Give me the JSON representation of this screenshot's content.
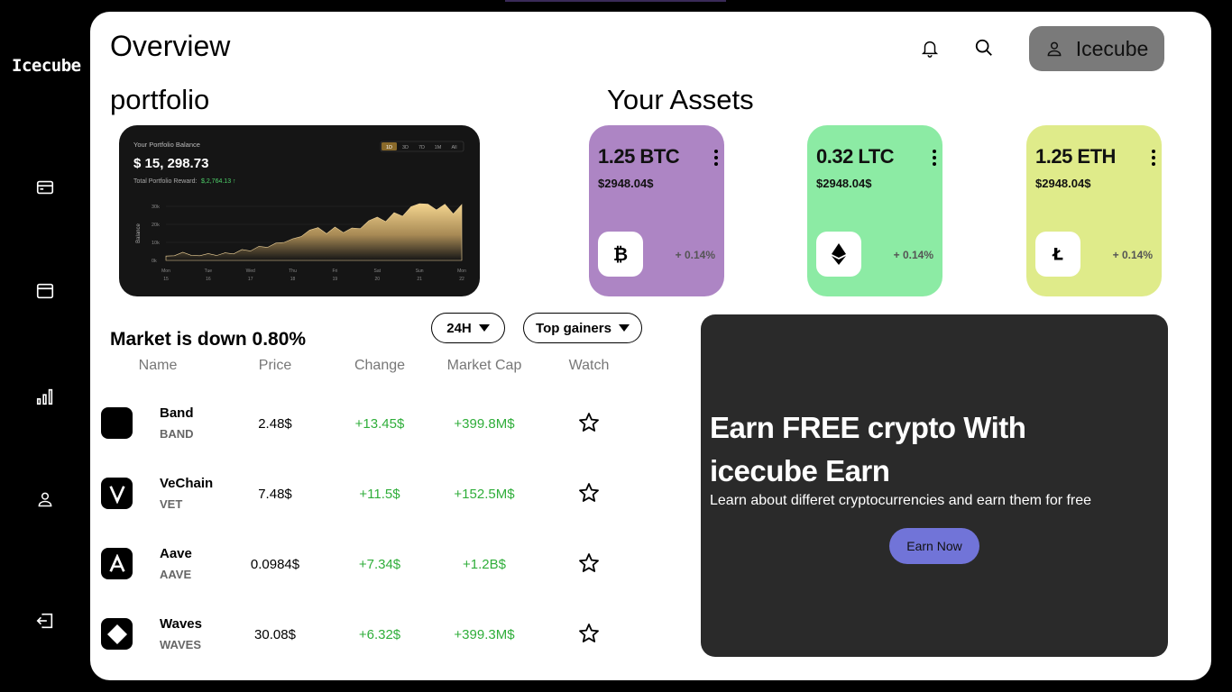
{
  "app": {
    "brand": "Icecube"
  },
  "sidebar": {
    "items": [
      {
        "name": "card-icon"
      },
      {
        "name": "wallet-icon"
      },
      {
        "name": "bar-chart-icon"
      },
      {
        "name": "user-icon"
      },
      {
        "name": "logout-icon"
      }
    ]
  },
  "header": {
    "title": "Overview",
    "user_label": "Icecube"
  },
  "portfolio": {
    "title": "portfolio",
    "card_title": "Your Portfolio Balance",
    "balance": "$ 15, 298.73",
    "reward_label": "Total Portfolio Reward:",
    "reward_value": "$,2,764.13",
    "ranges": [
      "1D",
      "3D",
      "7D",
      "1M",
      "All"
    ],
    "active_range": "1D",
    "y_label": "Balance",
    "y_ticks": [
      "30k",
      "20k",
      "10k",
      "0k"
    ],
    "x_ticks": [
      {
        "d": "Mon",
        "n": "15"
      },
      {
        "d": "Tue",
        "n": "16"
      },
      {
        "d": "Wed",
        "n": "17"
      },
      {
        "d": "Thu",
        "n": "18"
      },
      {
        "d": "Fri",
        "n": "19"
      },
      {
        "d": "Sat",
        "n": "20"
      },
      {
        "d": "Sun",
        "n": "21"
      },
      {
        "d": "Mon",
        "n": "22"
      }
    ],
    "series": [
      2.4,
      2.6,
      4.5,
      2.8,
      2.6,
      3.8,
      2.7,
      4.2,
      3.6,
      6.0,
      5.2,
      7.8,
      7.2,
      9.6,
      10.0,
      12.0,
      13.2,
      16.8,
      18.2,
      14.8,
      18.5,
      15.4,
      18.0,
      17.6,
      22.0,
      24.0,
      21.5,
      26.5,
      24.5,
      29.8,
      31.5,
      31.2,
      28.0,
      31.2,
      25.8,
      31.0
    ]
  },
  "assets": {
    "title": "Your Assets",
    "items": [
      {
        "amount": "1.25 BTC",
        "value": "$2948.04$",
        "change": "+ 0.14%",
        "coin": "bitcoin-icon",
        "color": "#ad85c4"
      },
      {
        "amount": "0.32 LTC",
        "value": "$2948.04$",
        "change": "+ 0.14%",
        "coin": "ethereum-icon",
        "color": "#8ceba4"
      },
      {
        "amount": "1.25 ETH",
        "value": "$2948.04$",
        "change": "+ 0.14%",
        "coin": "litecoin-icon",
        "color": "#dfeb8a"
      }
    ]
  },
  "market": {
    "title": "Market is down 0.80%",
    "period": "24H",
    "filter": "Top gainers",
    "columns": [
      "Name",
      "Price",
      "Change",
      "Market Cap",
      "Watch"
    ],
    "rows": [
      {
        "name": "Band",
        "ticker": "BAND",
        "price": "2.48$",
        "change": "+13.45$",
        "cap": "+399.8M$",
        "logo": "band-logo-icon"
      },
      {
        "name": "VeChain",
        "ticker": "VET",
        "price": "7.48$",
        "change": "+11.5$",
        "cap": "+152.5M$",
        "logo": "vechain-logo-icon"
      },
      {
        "name": "Aave",
        "ticker": "AAVE",
        "price": "0.0984$",
        "change": "+7.34$",
        "cap": "+1.2B$",
        "logo": "aave-logo-icon"
      },
      {
        "name": "Waves",
        "ticker": "WAVES",
        "price": "30.08$",
        "change": "+6.32$",
        "cap": "+399.3M$",
        "logo": "waves-logo-icon"
      }
    ]
  },
  "promo": {
    "headline": "Earn FREE crypto With icecube Earn",
    "subtitle": "Learn about differet cryptocurrencies and earn them for free",
    "cta": "Earn Now"
  },
  "colors": {
    "gain": "#2fae3a",
    "promo_bg": "#2a2a2a",
    "cta": "#7174d8"
  }
}
